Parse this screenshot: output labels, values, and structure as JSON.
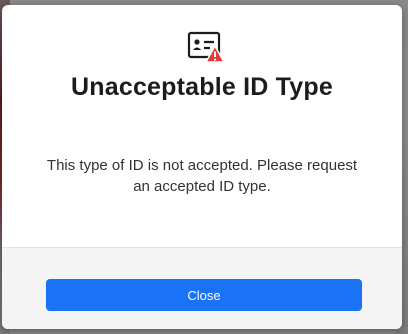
{
  "modal": {
    "icon": "id-card-warning-icon",
    "title": "Unacceptable ID Type",
    "message": "This type of ID is not accepted. Please request an accepted ID type.",
    "close_label": "Close",
    "accent_color": "#1a73f5",
    "warning_color": "#e53935"
  }
}
